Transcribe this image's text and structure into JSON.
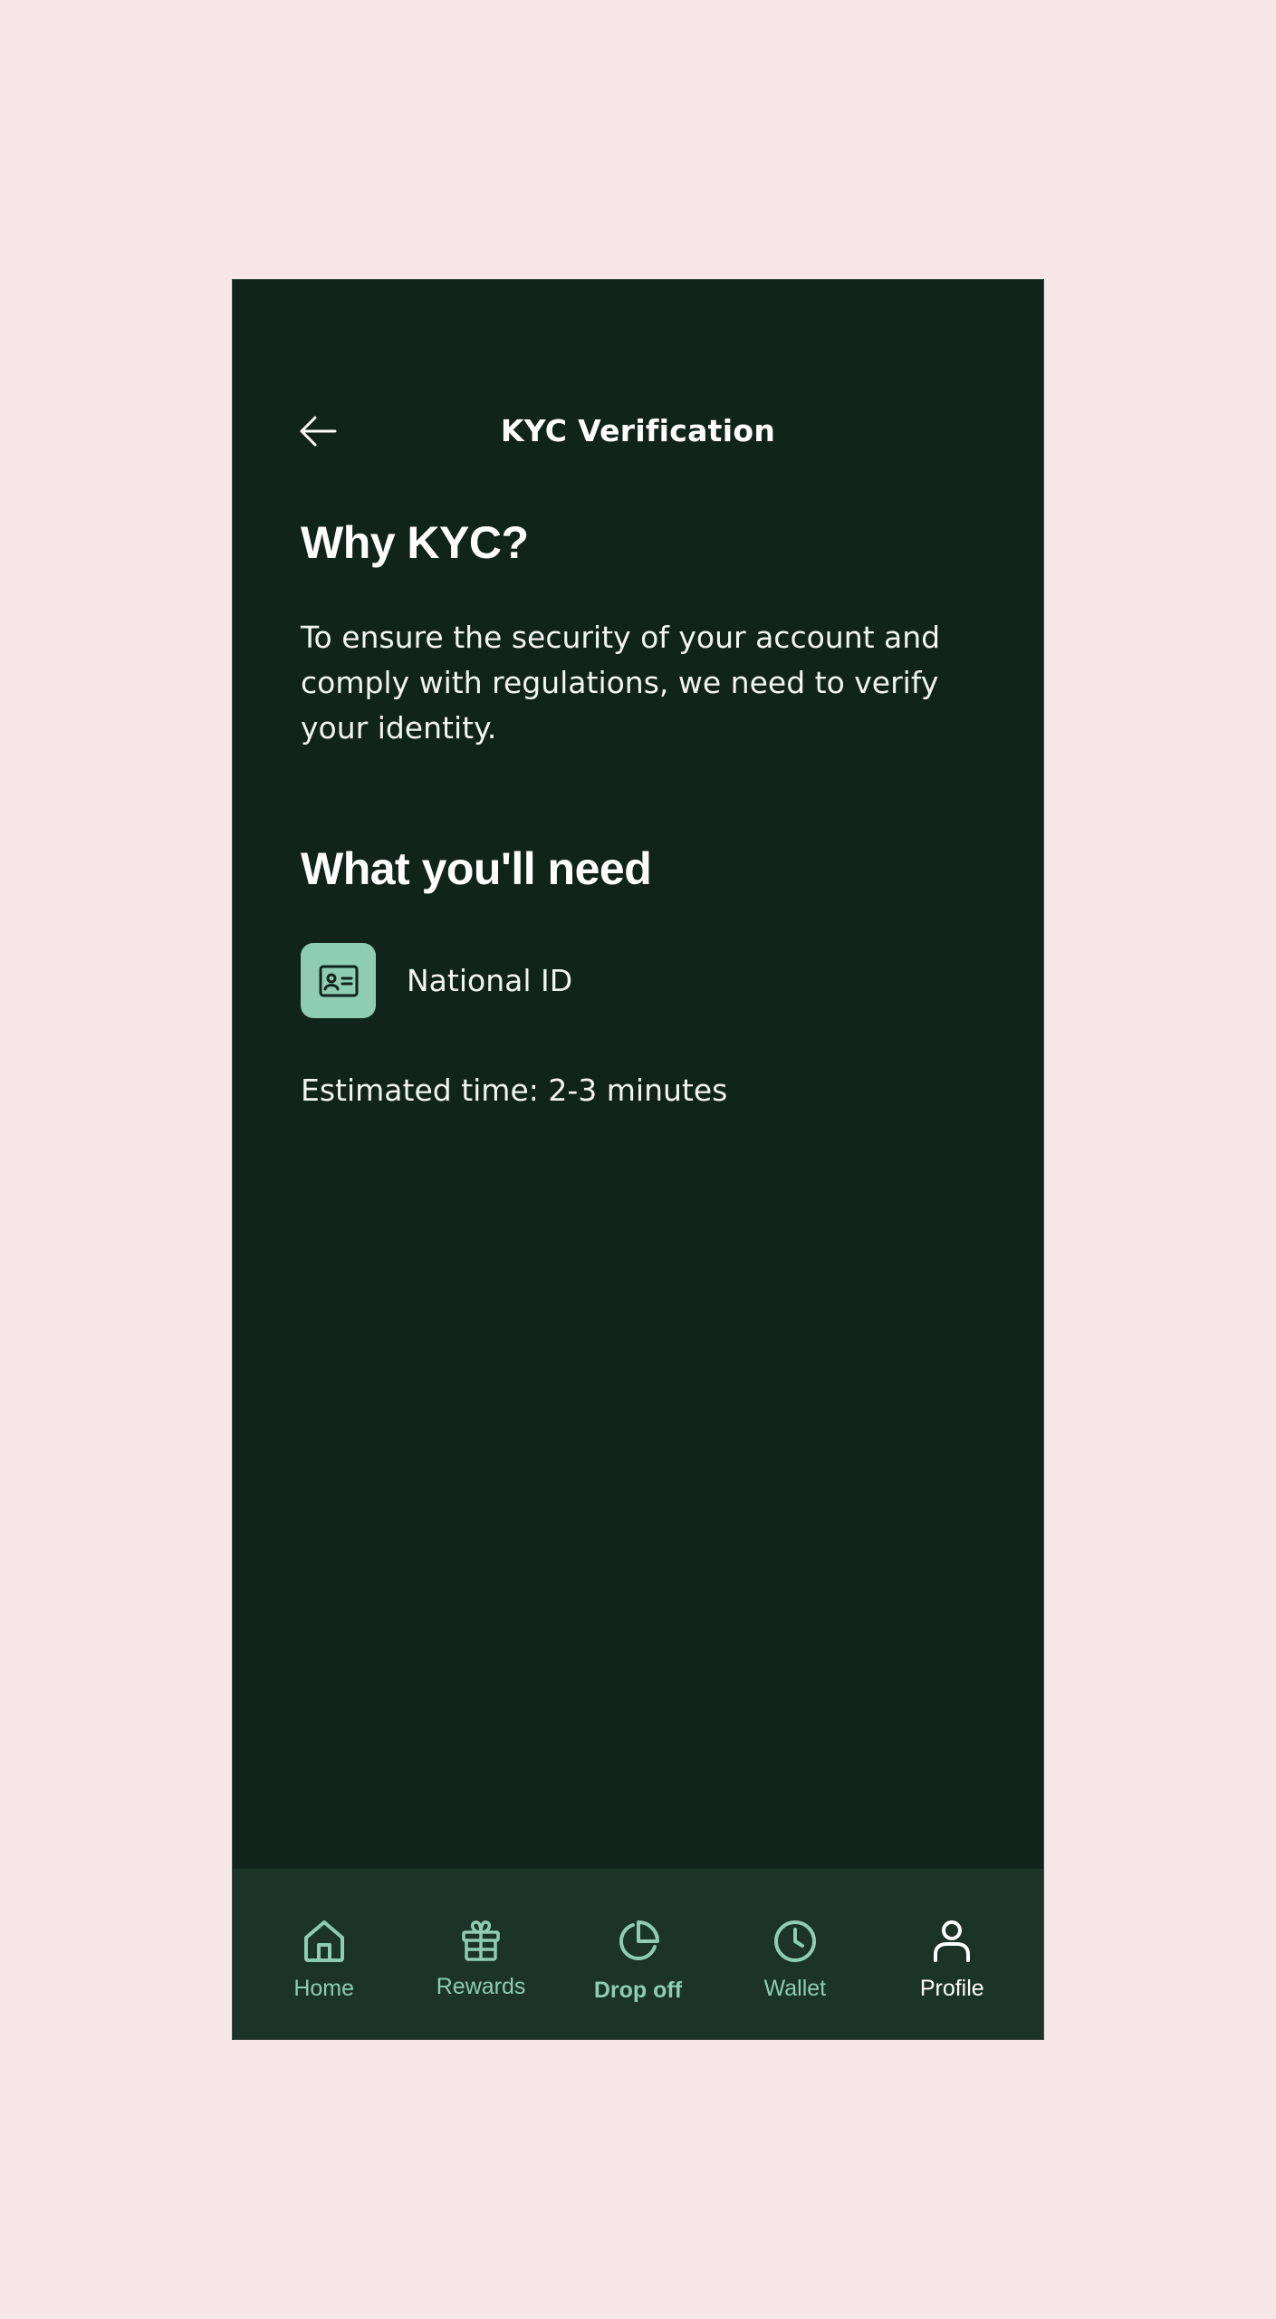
{
  "header": {
    "title": "KYC Verification",
    "back_icon": "arrow-left-icon"
  },
  "why": {
    "title": "Why KYC?",
    "text": "To ensure the security of your account and comply with regulations, we need to verify your identity."
  },
  "need": {
    "title": "What you'll need",
    "items": [
      {
        "icon": "id-card-icon",
        "label": "National ID"
      }
    ],
    "estimate": "Estimated time: 2-3 minutes"
  },
  "nav": {
    "items": [
      {
        "label": "Home",
        "icon": "home-icon",
        "active": false
      },
      {
        "label": "Rewards",
        "icon": "gift-icon",
        "active": false
      },
      {
        "label": "Drop off",
        "icon": "pie-chart-icon",
        "active": false
      },
      {
        "label": "Wallet",
        "icon": "clock-icon",
        "active": false
      },
      {
        "label": "Profile",
        "icon": "user-icon",
        "active": true
      }
    ]
  },
  "colors": {
    "background": "#10241c",
    "nav_background": "#1b3427",
    "accent": "#8ecdb1",
    "page_background": "#f7e6e6"
  }
}
